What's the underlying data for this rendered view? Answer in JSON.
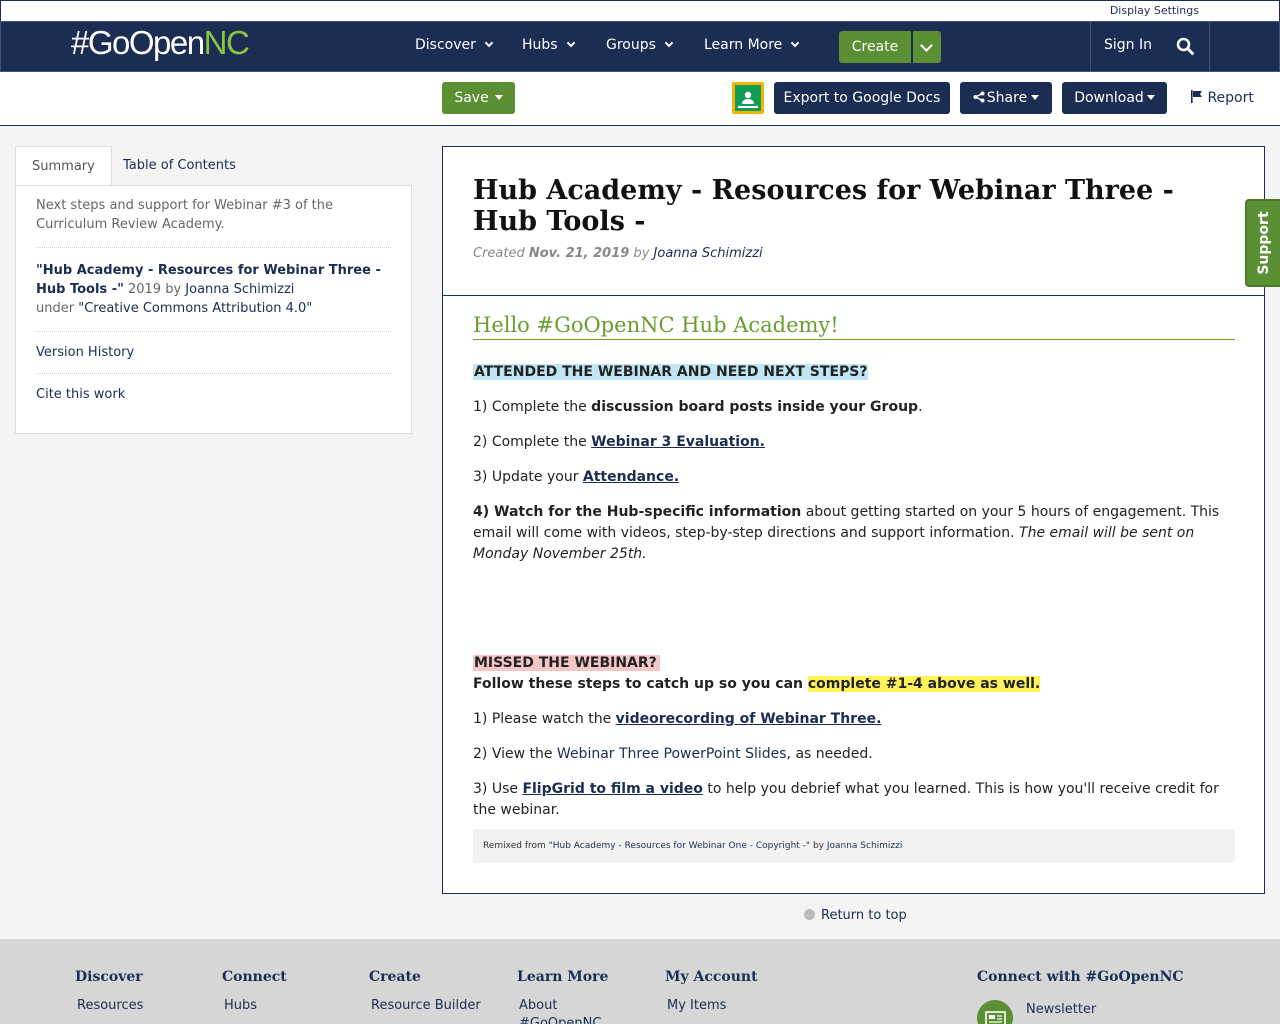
{
  "header": {
    "display_settings": "Display Settings",
    "logo_main": "#GoOpen",
    "logo_accent": "NC",
    "nav": [
      "Discover",
      "Hubs",
      "Groups",
      "Learn More"
    ],
    "create_label": "Create",
    "sign_in": "Sign In"
  },
  "toolbar": {
    "save": "Save",
    "export": "Export to Google Docs",
    "share": "Share",
    "download": "Download",
    "report": "Report"
  },
  "sidebar": {
    "tab_summary": "Summary",
    "tab_toc": "Table of Contents",
    "description": "Next steps and support for Webinar #3 of the Curriculum Review Academy.",
    "attribution_title": "\"Hub Academy - Resources for Webinar Three - Hub Tools -\"",
    "attribution_year_by": " 2019 by ",
    "attribution_author": "Joanna Schimizzi",
    "attribution_under": "under ",
    "attribution_license": "\"Creative Commons Attribution 4.0\"",
    "version_history": "Version History",
    "cite": "Cite this work"
  },
  "main": {
    "title": "Hub Academy - Resources for Webinar Three - Hub Tools -",
    "created_label": "Created ",
    "created_date": "Nov. 21, 2019",
    "by_label": " by ",
    "author": "Joanna Schimizzi",
    "hello": "Hello #GoOpenNC Hub Academy!",
    "attended_heading": "ATTENDED THE WEBINAR AND NEED NEXT STEPS?",
    "step1_pre": "1) Complete the ",
    "step1_bold": "discussion board posts inside your Group",
    "step1_post": ".",
    "step2_pre": "2) Complete the ",
    "step2_link": "Webinar 3 Evaluation. ",
    "step3_pre": "3) Update your ",
    "step3_link": "Attendance.",
    "step4_bold": "4) Watch for the Hub-specific information",
    "step4_text": " about getting started on your 5 hours of engagement. This email will come with videos, step-by-step directions and support information. ",
    "step4_italic": "The email will be sent on Monday November 25th.",
    "missed_heading": "MISSED THE WEBINAR? ",
    "follow_text": " Follow these steps to catch up so you can ",
    "follow_highlight": "complete #1-4 above as well.",
    "m1_pre": "1) Please watch the ",
    "m1_link": "videorecording of Webinar Three.",
    "m2_pre": "2) View the ",
    "m2_link": "Webinar Three PowerPoint Slides",
    "m2_post": ", as needed.",
    "m3_pre": "3) Use ",
    "m3_link": "FlipGrid to film a video",
    "m3_post": " to help you debrief what you learned. This is how you'll receive credit for the webinar.",
    "remixed_pre": "Remixed from ",
    "remixed_link": "\"Hub Academy - Resources for Webinar One - Copyright -\"",
    "remixed_by": " by ",
    "remixed_author": "Joanna Schimizzi"
  },
  "return_top": "Return to top",
  "support": "Support",
  "footer": {
    "discover": {
      "heading": "Discover",
      "link": "Resources"
    },
    "connect": {
      "heading": "Connect",
      "link": "Hubs"
    },
    "create": {
      "heading": "Create",
      "link": "Resource Builder"
    },
    "learn": {
      "heading": "Learn More",
      "link": "About",
      "link2": "#GoOpenNC"
    },
    "account": {
      "heading": "My Account",
      "link": "My Items"
    },
    "connect_with": {
      "heading": "Connect with #GoOpenNC",
      "link": "Newsletter"
    }
  },
  "colors": {
    "navy": "#1b2d52",
    "green": "#5b8f34",
    "hello_green": "#6a9d2f"
  }
}
